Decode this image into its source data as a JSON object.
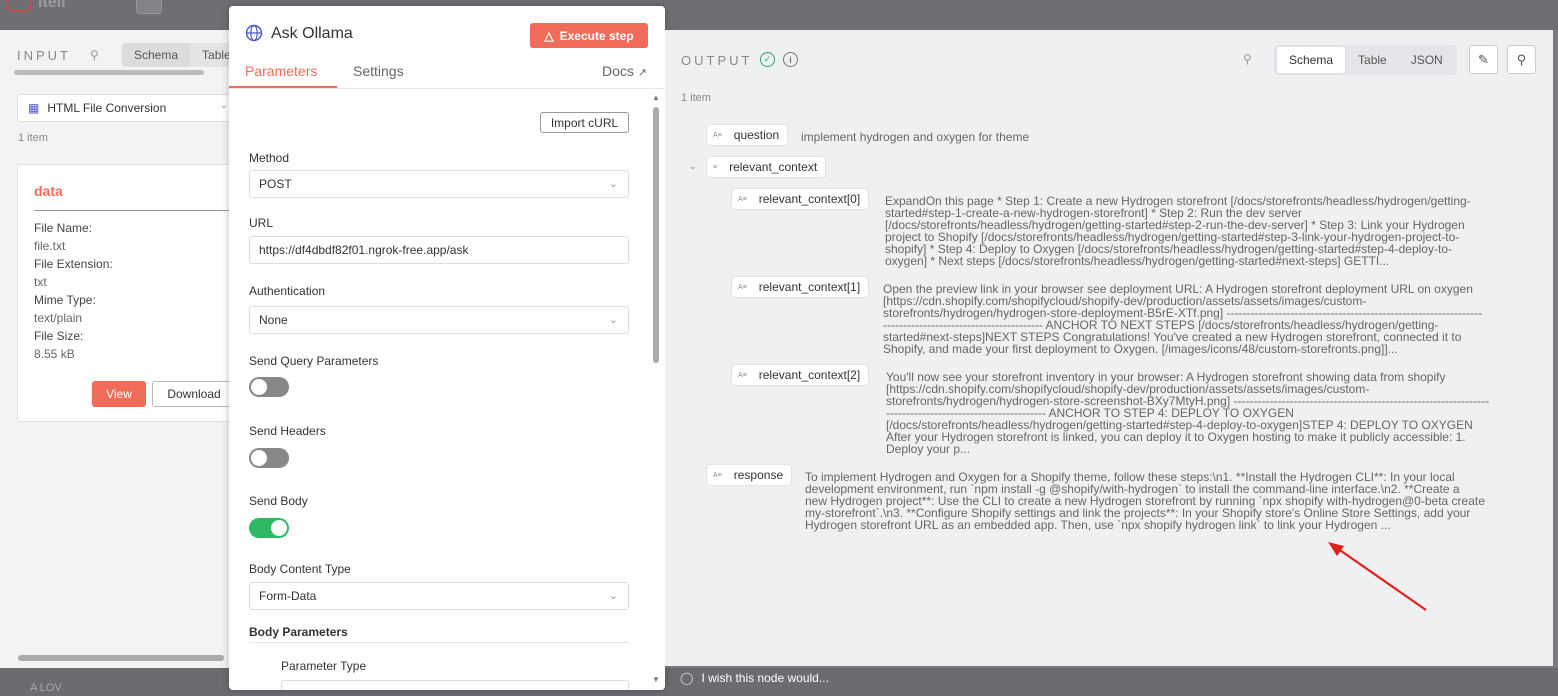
{
  "background": {
    "workflow_title": "Iteli",
    "bottom_node_label": "A LOV"
  },
  "input_panel": {
    "title": "INPUT",
    "tabs": [
      "Schema",
      "Table"
    ],
    "node_selector": "HTML File Conversion",
    "item_count": "1 item",
    "binary": {
      "name": "data",
      "fields": [
        {
          "label": "File Name:",
          "value": "file.txt"
        },
        {
          "label": "File Extension:",
          "value": "txt"
        },
        {
          "label": "Mime Type:",
          "value": "text/plain"
        },
        {
          "label": "File Size:",
          "value": "8.55 kB"
        }
      ],
      "view_label": "View",
      "download_label": "Download"
    }
  },
  "node_modal": {
    "title": "Ask Ollama",
    "execute_label": "Execute step",
    "tabs": {
      "parameters": "Parameters",
      "settings": "Settings",
      "docs": "Docs"
    },
    "import_curl_label": "Import cURL",
    "method": {
      "label": "Method",
      "value": "POST"
    },
    "url": {
      "label": "URL",
      "value": "https://df4dbdf82f01.ngrok-free.app/ask"
    },
    "authentication": {
      "label": "Authentication",
      "value": "None"
    },
    "send_query": {
      "label": "Send Query Parameters",
      "enabled": false
    },
    "send_headers": {
      "label": "Send Headers",
      "enabled": false
    },
    "send_body": {
      "label": "Send Body",
      "enabled": true
    },
    "body_content_type": {
      "label": "Body Content Type",
      "value": "Form-Data"
    },
    "body_parameters": {
      "label": "Body Parameters"
    },
    "parameter_type": {
      "label": "Parameter Type"
    }
  },
  "output_panel": {
    "title": "OUTPUT",
    "tabs": [
      "Schema",
      "Table",
      "JSON"
    ],
    "active_tab": "Schema",
    "item_count": "1 item",
    "fields": {
      "question": {
        "key": "question",
        "value": "implement hydrogen and oxygen for theme"
      },
      "relevant_context": {
        "key": "relevant_context"
      },
      "ctx0": {
        "key": "relevant_context[0]",
        "lines": [
          "ExpandOn this page * Step 1: Create a new Hydrogen storefront [/docs/storefronts/headless/hydrogen/getting-",
          "started#step-1-create-a-new-hydrogen-storefront] * Step 2: Run the dev server",
          "[/docs/storefronts/headless/hydrogen/getting-started#step-2-run-the-dev-server] * Step 3: Link your Hydrogen",
          "project to Shopify [/docs/storefronts/headless/hydrogen/getting-started#step-3-link-your-hydrogen-project-to-",
          "shopify] * Step 4: Deploy to Oxygen [/docs/storefronts/headless/hydrogen/getting-started#step-4-deploy-to-",
          "oxygen] * Next steps [/docs/storefronts/headless/hydrogen/getting-started#next-steps] GETTI..."
        ]
      },
      "ctx1": {
        "key": "relevant_context[1]",
        "lines": [
          "Open the preview link in your browser see deployment URL: A Hydrogen storefront deployment URL on oxygen",
          "[https://cdn.shopify.com/shopifycloud/shopify-dev/production/assets/assets/images/custom-",
          "storefronts/hydrogen/hydrogen-store-deployment-B5rE-XTf.png] ----------------------------------------------------------------",
          "---------------------------------------- ANCHOR TO NEXT STEPS [/docs/storefronts/headless/hydrogen/getting-",
          "started#next-steps]NEXT STEPS Congratulations! You've created a new Hydrogen storefront, connected it to",
          "Shopify, and made your first deployment to Oxygen. [/images/icons/48/custom-storefronts.png]]..."
        ]
      },
      "ctx2": {
        "key": "relevant_context[2]",
        "lines": [
          "You'll now see your storefront inventory in your browser: A Hydrogen storefront showing data from shopify",
          "[https://cdn.shopify.com/shopifycloud/shopify-dev/production/assets/assets/images/custom-",
          "storefronts/hydrogen/hydrogen-store-screenshot-BXy7MtyH.png] ----------------------------------------------------------------",
          "---------------------------------------- ANCHOR TO STEP 4: DEPLOY TO OXYGEN",
          "[/docs/storefronts/headless/hydrogen/getting-started#step-4-deploy-to-oxygen]STEP 4: DEPLOY TO OXYGEN",
          "After your Hydrogen storefront is linked, you can deploy it to Oxygen hosting to make it publicly accessible: 1.",
          "Deploy your p..."
        ]
      },
      "response": {
        "key": "response",
        "lines": [
          "To implement Hydrogen and Oxygen for a Shopify theme, follow these steps:\\n1. **Install the Hydrogen CLI**: In your local",
          "development environment, run `npm install -g @shopify/with-hydrogen` to install the command-line interface.\\n2. **Create a",
          "new Hydrogen project**: Use the CLI to create a new Hydrogen storefront by running `npx shopify with-hydrogen@0-beta create",
          "my-storefront`.\\n3. **Configure Shopify settings and link the projects**: In your Shopify store's Online Store Settings, add your",
          "Hydrogen storefront URL as an embedded app. Then, use `npx shopify hydrogen link` to link your Hydrogen ..."
        ]
      }
    }
  },
  "hint": "I wish this node would...",
  "colors": {
    "accent": "#ef6c5a",
    "success": "#2dba63",
    "annotation": "#e0201b"
  }
}
